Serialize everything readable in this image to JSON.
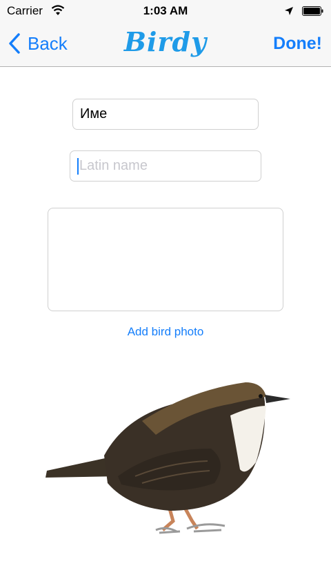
{
  "status_bar": {
    "carrier": "Carrier",
    "time": "1:03 AM",
    "icons": [
      "wifi-icon",
      "location-arrow-icon",
      "battery-icon"
    ]
  },
  "nav": {
    "back_label": "Back",
    "title": "Birdy",
    "done_label": "Done!"
  },
  "form": {
    "name_value": "Име",
    "latin_placeholder": "Latin name",
    "add_photo_label": "Add bird photo"
  },
  "colors": {
    "accent": "#147efb",
    "logo": "#1f9be8",
    "bar_background": "#f7f7f7"
  }
}
